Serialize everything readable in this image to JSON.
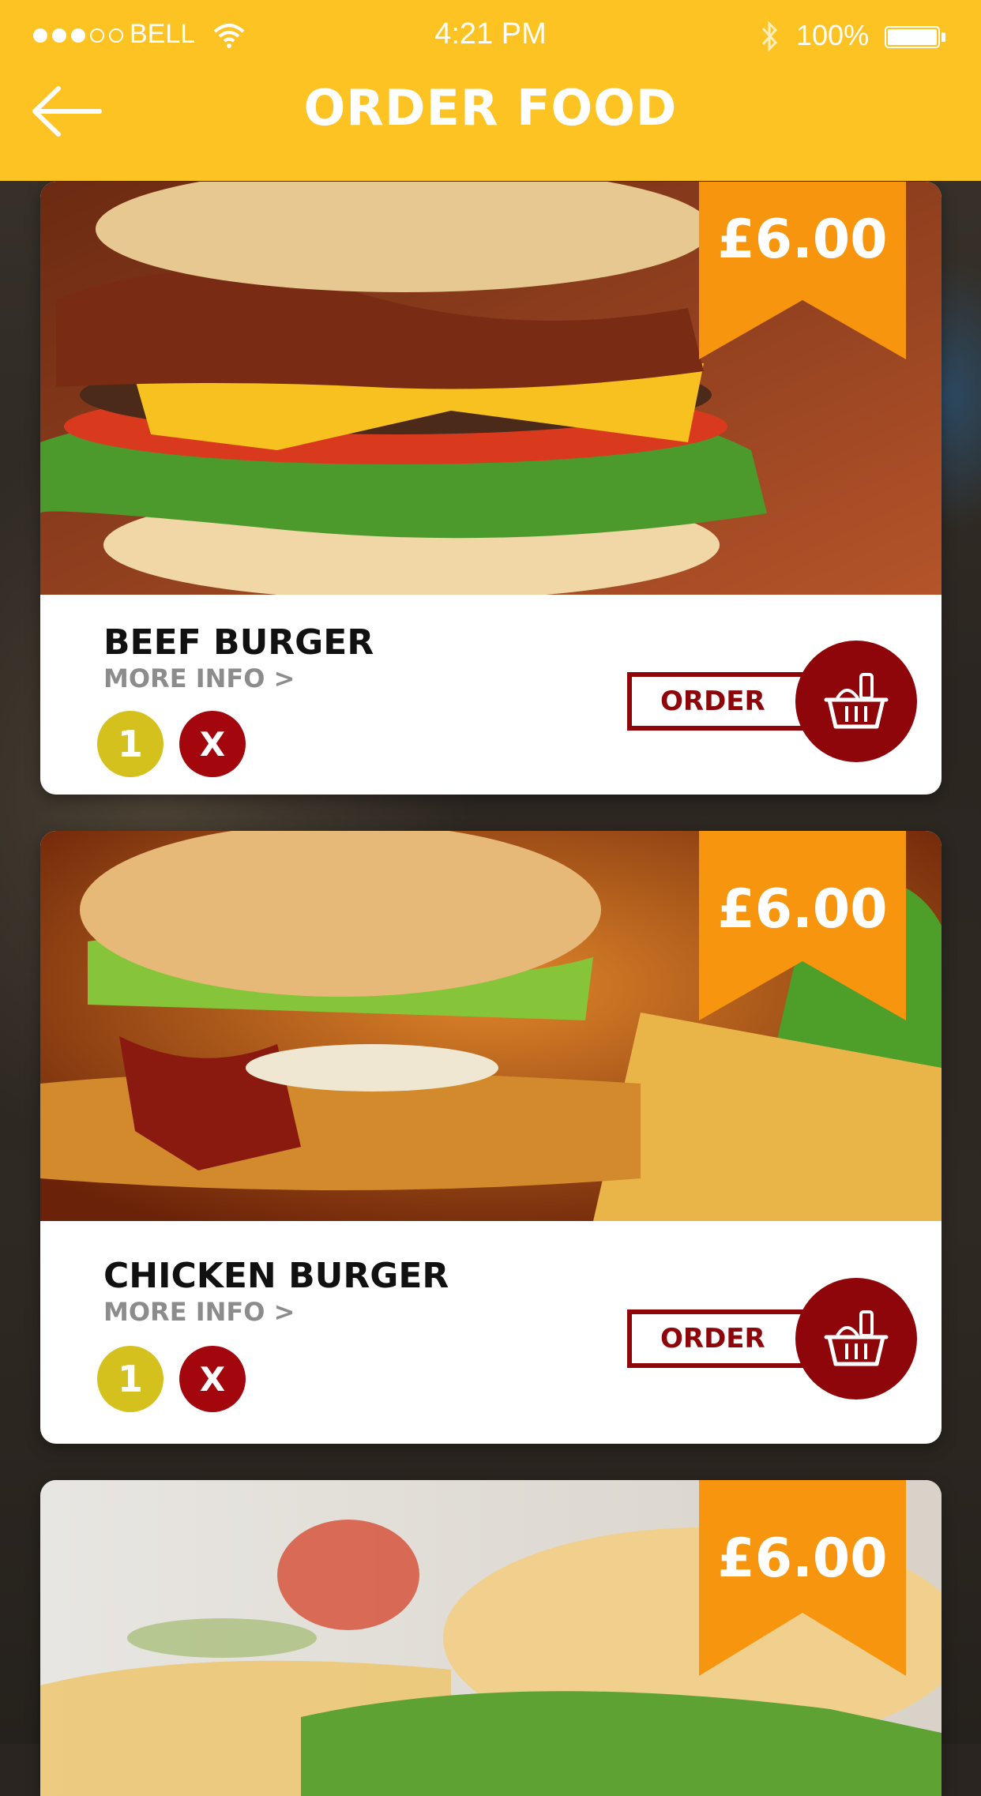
{
  "status_bar": {
    "carrier": "BELL",
    "time": "4:21 PM",
    "battery": "100%"
  },
  "header": {
    "title": "ORDER FOOD"
  },
  "items": [
    {
      "name": "BEEF BURGER",
      "price": "£6.00",
      "more_info": "MORE INFO >",
      "quantity": "1",
      "remove_label": "X",
      "order_label": "ORDER"
    },
    {
      "name": "CHICKEN BURGER",
      "price": "£6.00",
      "more_info": "MORE INFO >",
      "quantity": "1",
      "remove_label": "X",
      "order_label": "ORDER"
    },
    {
      "price": "£6.00"
    }
  ],
  "colors": {
    "header": "#fcc322",
    "ribbon": "#f7960e",
    "order": "#8e0609",
    "quantity": "#d4c11e",
    "remove": "#a3070d"
  },
  "icons": [
    "back-arrow-icon",
    "basket-icon",
    "wifi-icon",
    "bluetooth-icon",
    "battery-icon"
  ]
}
